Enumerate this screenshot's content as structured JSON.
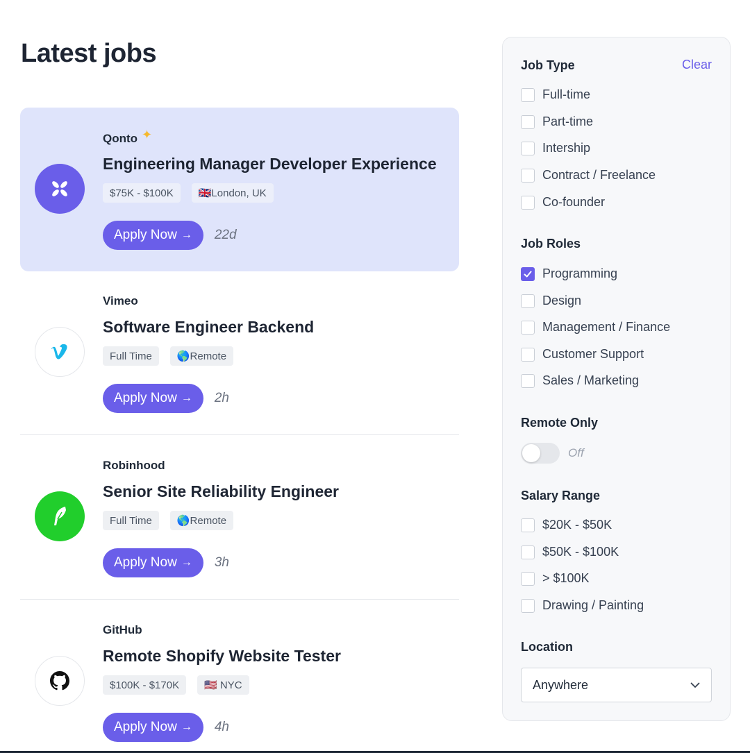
{
  "page": {
    "title": "Latest jobs"
  },
  "jobs": [
    {
      "company": "Qonto",
      "title": "Engineering Manager Developer Experience",
      "tags": [
        "$75K - $100K",
        "🇬🇧London, UK"
      ],
      "apply_label": "Apply Now",
      "age": "22d",
      "logo_icon": "qonto-logo-icon",
      "featured": true
    },
    {
      "company": "Vimeo",
      "title": "Software Engineer Backend",
      "tags": [
        "Full Time",
        "🌎Remote"
      ],
      "apply_label": "Apply Now",
      "age": "2h",
      "logo_icon": "vimeo-logo-icon"
    },
    {
      "company": "Robinhood",
      "title": "Senior Site Reliability Engineer",
      "tags": [
        "Full Time",
        "🌎Remote"
      ],
      "apply_label": "Apply Now",
      "age": "3h",
      "logo_icon": "robinhood-logo-icon"
    },
    {
      "company": "GitHub",
      "title": "Remote Shopify Website Tester",
      "tags": [
        "$100K - $170K",
        "🇺🇸 NYC"
      ],
      "apply_label": "Apply Now",
      "age": "4h",
      "logo_icon": "github-logo-icon"
    }
  ],
  "filters": {
    "job_type": {
      "label": "Job Type",
      "clear_label": "Clear",
      "options": [
        {
          "label": "Full-time",
          "checked": false
        },
        {
          "label": "Part-time",
          "checked": false
        },
        {
          "label": "Intership",
          "checked": false
        },
        {
          "label": "Contract / Freelance",
          "checked": false
        },
        {
          "label": "Co-founder",
          "checked": false
        }
      ]
    },
    "job_roles": {
      "label": "Job Roles",
      "options": [
        {
          "label": "Programming",
          "checked": true
        },
        {
          "label": "Design",
          "checked": false
        },
        {
          "label": "Management / Finance",
          "checked": false
        },
        {
          "label": "Customer Support",
          "checked": false
        },
        {
          "label": "Sales / Marketing",
          "checked": false
        }
      ]
    },
    "remote_only": {
      "label": "Remote Only",
      "state_label": "Off",
      "on": false
    },
    "salary_range": {
      "label": "Salary Range",
      "options": [
        {
          "label": "$20K - $50K",
          "checked": false
        },
        {
          "label": "$50K - $100K",
          "checked": false
        },
        {
          "label": "> $100K",
          "checked": false
        },
        {
          "label": "Drawing / Painting",
          "checked": false
        }
      ]
    },
    "location": {
      "label": "Location",
      "selected": "Anywhere"
    }
  },
  "colors": {
    "accent": "#6a5ee9",
    "featured_bg": "#dfe4fb",
    "robinhood_green": "#21ce2c",
    "sparkle": "#f5b82e"
  }
}
